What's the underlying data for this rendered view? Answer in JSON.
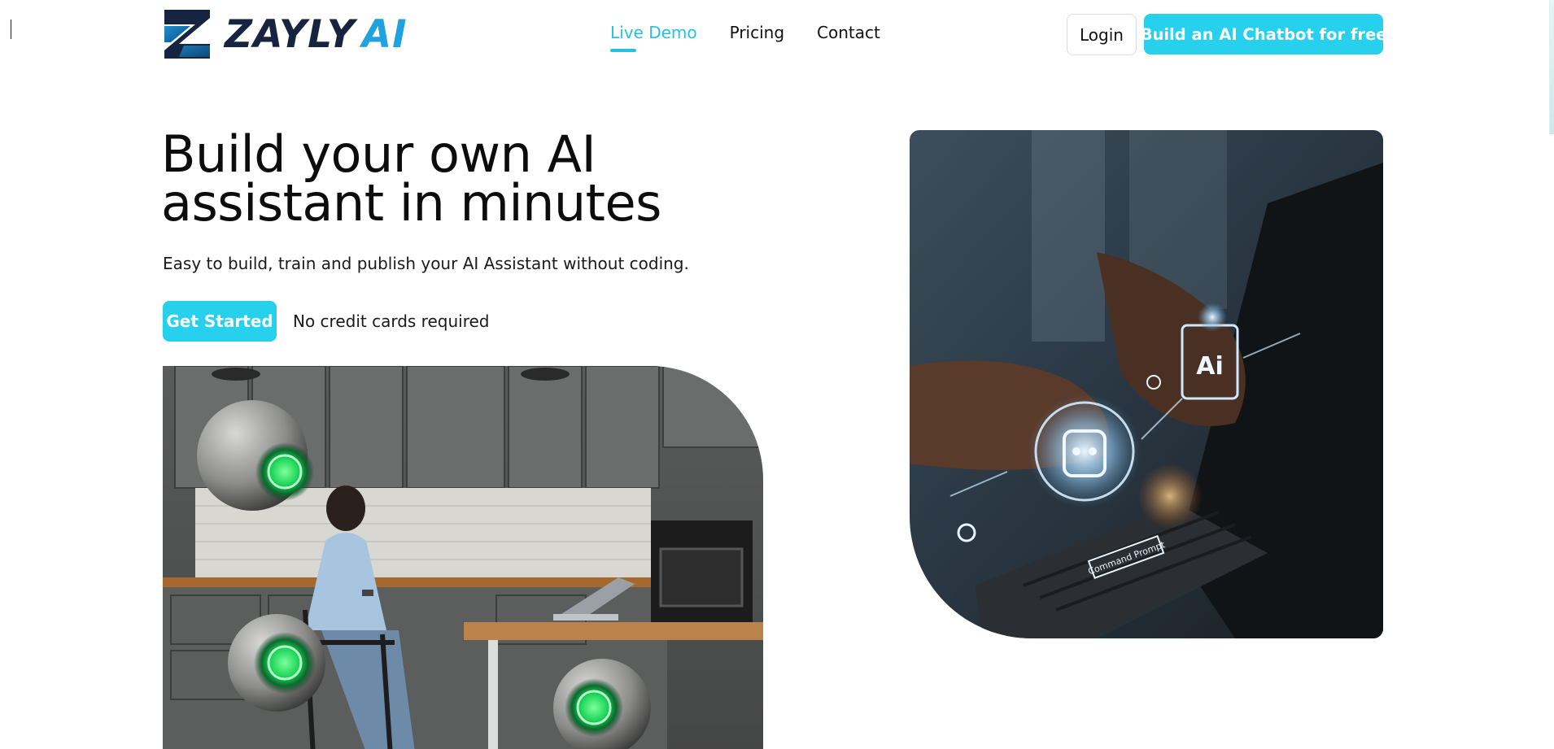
{
  "brand": {
    "name": "ZAYLY",
    "suffix": "AI",
    "colors": {
      "navy": "#16243f",
      "blue": "#1fa2df",
      "accent": "#27d0ec"
    }
  },
  "nav": {
    "items": [
      {
        "label": "Live Demo",
        "active": true
      },
      {
        "label": "Pricing",
        "active": false
      },
      {
        "label": "Contact",
        "active": false
      }
    ],
    "login_label": "Login",
    "cta_label": "Build an AI Chatbot for free"
  },
  "hero": {
    "title_line1": "Build your own AI",
    "title_line2": "assistant in minutes",
    "subtitle": "Easy to build, train and publish your AI Assistant without coding.",
    "get_started_label": "Get Started",
    "no_cc_text": "No credit cards required"
  },
  "images": {
    "kitchen": {
      "label": "woman-in-kitchen-with-floating-robots"
    },
    "laptop": {
      "label": "hands-typing-on-laptop-with-ai-hologram",
      "hologram_text": "Ai",
      "prompt_text": "Command Prompt"
    }
  }
}
